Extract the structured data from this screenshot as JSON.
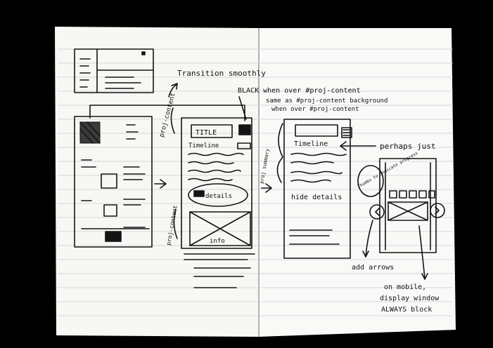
{
  "notes": {
    "transition": "Transition smoothly",
    "black_over": "BLACK when over #proj-content",
    "same_as": "same as #proj-content background",
    "when_over": "when over #proj-content",
    "proj_content_label": "proj-content",
    "title_box": "TITLE",
    "timeline_left": "Timeline",
    "timeline_right": "Timeline",
    "details": "details",
    "info": "info",
    "hide_details": "hide details",
    "perhaps_just": "perhaps just",
    "proj_content_vertical": "proj-content",
    "proj_summary": "proj summary",
    "thumbs": "Thumbs to indicate progress",
    "add_arrows": "add arrows",
    "mobile1": "on mobile,",
    "mobile2": "display window",
    "mobile3": "ALWAYS block"
  },
  "colors": {
    "paper": "#f7f7f4",
    "ink": "#141414",
    "rule": "#c9ccd3",
    "background": "#000000"
  }
}
